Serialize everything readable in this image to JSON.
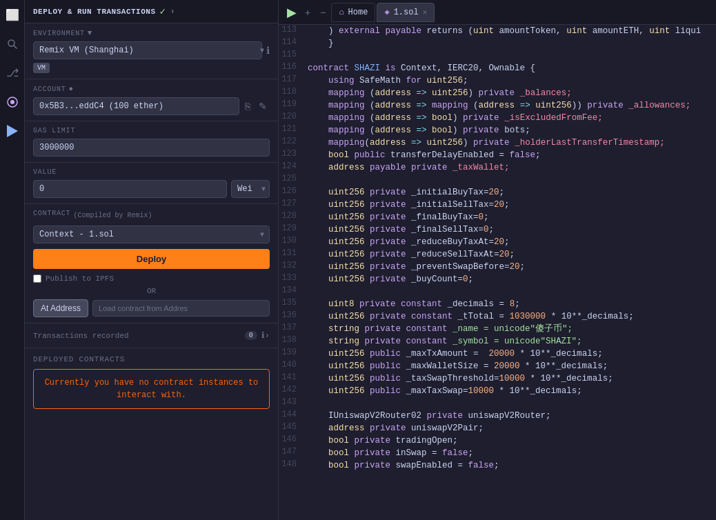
{
  "header": {
    "title": "DEPLOY & RUN TRANSACTIONS",
    "check_label": "✓",
    "arrow_label": "›"
  },
  "sidebar": {
    "env_label": "ENVIRONMENT",
    "env_value": "Remix VM (Shanghai)",
    "vm_badge": "VM",
    "account_label": "ACCOUNT",
    "account_value": "0x5B3...eddC4 (100 ether)",
    "gas_limit_label": "GAS LIMIT",
    "gas_limit_value": "3000000",
    "value_label": "VALUE",
    "value_amount": "0",
    "value_unit": "Wei",
    "contract_label": "CONTRACT",
    "contract_sublabel": "(Compiled by Remix)",
    "contract_value": "Context - 1.sol",
    "deploy_label": "Deploy",
    "publish_label": "Publish to IPFS",
    "or_label": "OR",
    "at_address_label": "At Address",
    "load_contract_label": "Load contract from Addres",
    "transactions_label": "Transactions recorded",
    "tx_count": "0",
    "deployed_label": "Deployed Contracts",
    "no_contracts_text": "Currently you have no contract instances to interact with."
  },
  "tabs": {
    "home_label": "Home",
    "file_label": "1.sol",
    "run_icon": "▶",
    "zoom_in": "+",
    "zoom_out": "−"
  },
  "code_lines": [
    {
      "num": 113,
      "tokens": [
        {
          "t": "    ) ",
          "c": ""
        },
        {
          "t": "external",
          "c": "kw"
        },
        {
          "t": " ",
          "c": ""
        },
        {
          "t": "payable",
          "c": "kw"
        },
        {
          "t": " returns (",
          "c": ""
        },
        {
          "t": "uint",
          "c": "type"
        },
        {
          "t": " amountToken, ",
          "c": ""
        },
        {
          "t": "uint",
          "c": "type"
        },
        {
          "t": " amountETH, ",
          "c": ""
        },
        {
          "t": "uint",
          "c": "type"
        },
        {
          "t": " liqui",
          "c": ""
        }
      ]
    },
    {
      "num": 114,
      "tokens": [
        {
          "t": "    }",
          "c": ""
        }
      ]
    },
    {
      "num": 115,
      "tokens": []
    },
    {
      "num": 116,
      "tokens": [
        {
          "t": "contract",
          "c": "kw"
        },
        {
          "t": " SHAZI ",
          "c": "fn"
        },
        {
          "t": "is",
          "c": "kw"
        },
        {
          "t": " Context, IERC20, Ownable {",
          "c": ""
        }
      ]
    },
    {
      "num": 117,
      "tokens": [
        {
          "t": "    ",
          "c": ""
        },
        {
          "t": "using",
          "c": "kw"
        },
        {
          "t": " SafeMath ",
          "c": ""
        },
        {
          "t": "for",
          "c": "kw"
        },
        {
          "t": " ",
          "c": ""
        },
        {
          "t": "uint256",
          "c": "type"
        },
        {
          "t": ";",
          "c": ""
        }
      ]
    },
    {
      "num": 118,
      "tokens": [
        {
          "t": "    ",
          "c": ""
        },
        {
          "t": "mapping",
          "c": "kw"
        },
        {
          "t": " (",
          "c": ""
        },
        {
          "t": "address",
          "c": "type"
        },
        {
          "t": " => ",
          "c": "op"
        },
        {
          "t": "uint256",
          "c": "type"
        },
        {
          "t": ") ",
          "c": ""
        },
        {
          "t": "private",
          "c": "kw"
        },
        {
          "t": " _balances;",
          "c": "priv"
        }
      ]
    },
    {
      "num": 119,
      "tokens": [
        {
          "t": "    ",
          "c": ""
        },
        {
          "t": "mapping",
          "c": "kw"
        },
        {
          "t": " (",
          "c": ""
        },
        {
          "t": "address",
          "c": "type"
        },
        {
          "t": " => ",
          "c": "op"
        },
        {
          "t": "mapping",
          "c": "kw"
        },
        {
          "t": " (",
          "c": ""
        },
        {
          "t": "address",
          "c": "type"
        },
        {
          "t": " => ",
          "c": "op"
        },
        {
          "t": "uint256",
          "c": "type"
        },
        {
          "t": ")) ",
          "c": ""
        },
        {
          "t": "private",
          "c": "kw"
        },
        {
          "t": " _allowances;",
          "c": "priv"
        }
      ]
    },
    {
      "num": 120,
      "tokens": [
        {
          "t": "    ",
          "c": ""
        },
        {
          "t": "mapping",
          "c": "kw"
        },
        {
          "t": " (",
          "c": ""
        },
        {
          "t": "address",
          "c": "type"
        },
        {
          "t": " => ",
          "c": "op"
        },
        {
          "t": "bool",
          "c": "type"
        },
        {
          "t": ") ",
          "c": ""
        },
        {
          "t": "private",
          "c": "kw"
        },
        {
          "t": " _isExcludedFromFee;",
          "c": "priv"
        }
      ]
    },
    {
      "num": 121,
      "tokens": [
        {
          "t": "    ",
          "c": ""
        },
        {
          "t": "mapping",
          "c": "kw"
        },
        {
          "t": " (",
          "c": ""
        },
        {
          "t": "address",
          "c": "type"
        },
        {
          "t": " => ",
          "c": "op"
        },
        {
          "t": "bool",
          "c": "type"
        },
        {
          "t": ") ",
          "c": ""
        },
        {
          "t": "private",
          "c": "kw"
        },
        {
          "t": " bots;",
          "c": ""
        }
      ]
    },
    {
      "num": 122,
      "tokens": [
        {
          "t": "    ",
          "c": ""
        },
        {
          "t": "mapping",
          "c": "kw"
        },
        {
          "t": "(",
          "c": ""
        },
        {
          "t": "address",
          "c": "type"
        },
        {
          "t": " => ",
          "c": "op"
        },
        {
          "t": "uint256",
          "c": "type"
        },
        {
          "t": ") ",
          "c": ""
        },
        {
          "t": "private",
          "c": "kw"
        },
        {
          "t": " _holderLastTransferTimestamp;",
          "c": "priv"
        }
      ]
    },
    {
      "num": 123,
      "tokens": [
        {
          "t": "    ",
          "c": ""
        },
        {
          "t": "bool",
          "c": "type"
        },
        {
          "t": " ",
          "c": ""
        },
        {
          "t": "public",
          "c": "kw"
        },
        {
          "t": " transferDelayEnabled = ",
          "c": ""
        },
        {
          "t": "false",
          "c": "kw"
        },
        {
          "t": ";",
          "c": ""
        }
      ]
    },
    {
      "num": 124,
      "tokens": [
        {
          "t": "    ",
          "c": ""
        },
        {
          "t": "address",
          "c": "type"
        },
        {
          "t": " ",
          "c": ""
        },
        {
          "t": "payable",
          "c": "kw"
        },
        {
          "t": " ",
          "c": ""
        },
        {
          "t": "private",
          "c": "kw"
        },
        {
          "t": " _taxWallet;",
          "c": "priv"
        }
      ]
    },
    {
      "num": 125,
      "tokens": []
    },
    {
      "num": 126,
      "tokens": [
        {
          "t": "    ",
          "c": ""
        },
        {
          "t": "uint256",
          "c": "type"
        },
        {
          "t": " ",
          "c": ""
        },
        {
          "t": "private",
          "c": "kw"
        },
        {
          "t": " _initialBuyTax=",
          "c": ""
        },
        {
          "t": "20",
          "c": "num"
        },
        {
          "t": ";",
          "c": ""
        }
      ]
    },
    {
      "num": 127,
      "tokens": [
        {
          "t": "    ",
          "c": ""
        },
        {
          "t": "uint256",
          "c": "type"
        },
        {
          "t": " ",
          "c": ""
        },
        {
          "t": "private",
          "c": "kw"
        },
        {
          "t": " _initialSellTax=",
          "c": ""
        },
        {
          "t": "20",
          "c": "num"
        },
        {
          "t": ";",
          "c": ""
        }
      ]
    },
    {
      "num": 128,
      "tokens": [
        {
          "t": "    ",
          "c": ""
        },
        {
          "t": "uint256",
          "c": "type"
        },
        {
          "t": " ",
          "c": ""
        },
        {
          "t": "private",
          "c": "kw"
        },
        {
          "t": " _finalBuyTax=",
          "c": ""
        },
        {
          "t": "0",
          "c": "num"
        },
        {
          "t": ";",
          "c": ""
        }
      ]
    },
    {
      "num": 129,
      "tokens": [
        {
          "t": "    ",
          "c": ""
        },
        {
          "t": "uint256",
          "c": "type"
        },
        {
          "t": " ",
          "c": ""
        },
        {
          "t": "private",
          "c": "kw"
        },
        {
          "t": " _finalSellTax=",
          "c": ""
        },
        {
          "t": "0",
          "c": "num"
        },
        {
          "t": ";",
          "c": ""
        }
      ]
    },
    {
      "num": 130,
      "tokens": [
        {
          "t": "    ",
          "c": ""
        },
        {
          "t": "uint256",
          "c": "type"
        },
        {
          "t": " ",
          "c": ""
        },
        {
          "t": "private",
          "c": "kw"
        },
        {
          "t": " _reduceBuyTaxAt=",
          "c": ""
        },
        {
          "t": "20",
          "c": "num"
        },
        {
          "t": ";",
          "c": ""
        }
      ]
    },
    {
      "num": 131,
      "tokens": [
        {
          "t": "    ",
          "c": ""
        },
        {
          "t": "uint256",
          "c": "type"
        },
        {
          "t": " ",
          "c": ""
        },
        {
          "t": "private",
          "c": "kw"
        },
        {
          "t": " _reduceSellTaxAt=",
          "c": ""
        },
        {
          "t": "20",
          "c": "num"
        },
        {
          "t": ";",
          "c": ""
        }
      ]
    },
    {
      "num": 132,
      "tokens": [
        {
          "t": "    ",
          "c": ""
        },
        {
          "t": "uint256",
          "c": "type"
        },
        {
          "t": " ",
          "c": ""
        },
        {
          "t": "private",
          "c": "kw"
        },
        {
          "t": " _preventSwapBefore=",
          "c": ""
        },
        {
          "t": "20",
          "c": "num"
        },
        {
          "t": ";",
          "c": ""
        }
      ]
    },
    {
      "num": 133,
      "tokens": [
        {
          "t": "    ",
          "c": ""
        },
        {
          "t": "uint256",
          "c": "type"
        },
        {
          "t": " ",
          "c": ""
        },
        {
          "t": "private",
          "c": "kw"
        },
        {
          "t": " _buyCount=",
          "c": ""
        },
        {
          "t": "0",
          "c": "num"
        },
        {
          "t": ";",
          "c": ""
        }
      ]
    },
    {
      "num": 134,
      "tokens": []
    },
    {
      "num": 135,
      "tokens": [
        {
          "t": "    ",
          "c": ""
        },
        {
          "t": "uint8",
          "c": "type"
        },
        {
          "t": " ",
          "c": ""
        },
        {
          "t": "private",
          "c": "kw"
        },
        {
          "t": " ",
          "c": ""
        },
        {
          "t": "constant",
          "c": "kw"
        },
        {
          "t": " _decimals = ",
          "c": ""
        },
        {
          "t": "8",
          "c": "num"
        },
        {
          "t": ";",
          "c": ""
        }
      ]
    },
    {
      "num": 136,
      "tokens": [
        {
          "t": "    ",
          "c": ""
        },
        {
          "t": "uint256",
          "c": "type"
        },
        {
          "t": " ",
          "c": ""
        },
        {
          "t": "private",
          "c": "kw"
        },
        {
          "t": " ",
          "c": ""
        },
        {
          "t": "constant",
          "c": "kw"
        },
        {
          "t": " _tTotal = ",
          "c": ""
        },
        {
          "t": "1030000",
          "c": "num"
        },
        {
          "t": " * 10**_decimals;",
          "c": ""
        }
      ]
    },
    {
      "num": 137,
      "tokens": [
        {
          "t": "    ",
          "c": ""
        },
        {
          "t": "string",
          "c": "type"
        },
        {
          "t": " ",
          "c": ""
        },
        {
          "t": "private",
          "c": "kw"
        },
        {
          "t": " ",
          "c": ""
        },
        {
          "t": "constant",
          "c": "kw"
        },
        {
          "t": " _name = unicode\"傻子币\";",
          "c": "str"
        }
      ]
    },
    {
      "num": 138,
      "tokens": [
        {
          "t": "    ",
          "c": ""
        },
        {
          "t": "string",
          "c": "type"
        },
        {
          "t": " ",
          "c": ""
        },
        {
          "t": "private",
          "c": "kw"
        },
        {
          "t": " ",
          "c": ""
        },
        {
          "t": "constant",
          "c": "kw"
        },
        {
          "t": " _symbol = unicode\"SHAZI\";",
          "c": "str"
        }
      ]
    },
    {
      "num": 139,
      "tokens": [
        {
          "t": "    ",
          "c": ""
        },
        {
          "t": "uint256",
          "c": "type"
        },
        {
          "t": " ",
          "c": ""
        },
        {
          "t": "public",
          "c": "kw"
        },
        {
          "t": " _maxTxAmount =  ",
          "c": ""
        },
        {
          "t": "20000",
          "c": "num"
        },
        {
          "t": " * 10**_decimals;",
          "c": ""
        }
      ]
    },
    {
      "num": 140,
      "tokens": [
        {
          "t": "    ",
          "c": ""
        },
        {
          "t": "uint256",
          "c": "type"
        },
        {
          "t": " ",
          "c": ""
        },
        {
          "t": "public",
          "c": "kw"
        },
        {
          "t": " _maxWalletSize = ",
          "c": ""
        },
        {
          "t": "20000",
          "c": "num"
        },
        {
          "t": " * 10**_decimals;",
          "c": ""
        }
      ]
    },
    {
      "num": 141,
      "tokens": [
        {
          "t": "    ",
          "c": ""
        },
        {
          "t": "uint256",
          "c": "type"
        },
        {
          "t": " ",
          "c": ""
        },
        {
          "t": "public",
          "c": "kw"
        },
        {
          "t": " _taxSwapThreshold=",
          "c": ""
        },
        {
          "t": "10000",
          "c": "num"
        },
        {
          "t": " * 10**_decimals;",
          "c": ""
        }
      ]
    },
    {
      "num": 142,
      "tokens": [
        {
          "t": "    ",
          "c": ""
        },
        {
          "t": "uint256",
          "c": "type"
        },
        {
          "t": " ",
          "c": ""
        },
        {
          "t": "public",
          "c": "kw"
        },
        {
          "t": " _maxTaxSwap=",
          "c": ""
        },
        {
          "t": "10000",
          "c": "num"
        },
        {
          "t": " * 10**_decimals;",
          "c": ""
        }
      ]
    },
    {
      "num": 143,
      "tokens": []
    },
    {
      "num": 144,
      "tokens": [
        {
          "t": "    IUniswapV2Router02 ",
          "c": ""
        },
        {
          "t": "private",
          "c": "kw"
        },
        {
          "t": " uniswapV2Router;",
          "c": ""
        }
      ]
    },
    {
      "num": 145,
      "tokens": [
        {
          "t": "    ",
          "c": ""
        },
        {
          "t": "address",
          "c": "type"
        },
        {
          "t": " ",
          "c": ""
        },
        {
          "t": "private",
          "c": "kw"
        },
        {
          "t": " uniswapV2Pair;",
          "c": ""
        }
      ]
    },
    {
      "num": 146,
      "tokens": [
        {
          "t": "    ",
          "c": ""
        },
        {
          "t": "bool",
          "c": "type"
        },
        {
          "t": " ",
          "c": ""
        },
        {
          "t": "private",
          "c": "kw"
        },
        {
          "t": " tradingOpen;",
          "c": ""
        }
      ]
    },
    {
      "num": 147,
      "tokens": [
        {
          "t": "    ",
          "c": ""
        },
        {
          "t": "bool",
          "c": "type"
        },
        {
          "t": " ",
          "c": ""
        },
        {
          "t": "private",
          "c": "kw"
        },
        {
          "t": " inSwap = ",
          "c": ""
        },
        {
          "t": "false",
          "c": "kw"
        },
        {
          "t": ";",
          "c": ""
        }
      ]
    },
    {
      "num": 148,
      "tokens": [
        {
          "t": "    ",
          "c": ""
        },
        {
          "t": "bool",
          "c": "type"
        },
        {
          "t": " ",
          "c": ""
        },
        {
          "t": "private",
          "c": "kw"
        },
        {
          "t": " swapEnabled = ",
          "c": ""
        },
        {
          "t": "false",
          "c": "kw"
        },
        {
          "t": ";",
          "c": ""
        }
      ]
    }
  ]
}
